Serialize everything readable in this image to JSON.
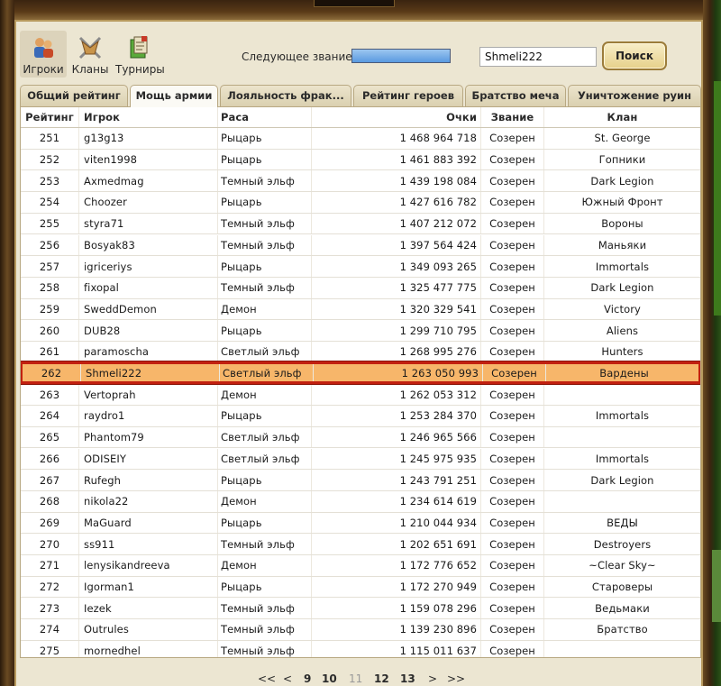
{
  "nav": [
    {
      "label": "Игроки",
      "active": true,
      "icon": "players-icon"
    },
    {
      "label": "Кланы",
      "active": false,
      "icon": "clans-icon"
    },
    {
      "label": "Турниры",
      "active": false,
      "icon": "tournaments-icon"
    }
  ],
  "next_rank": {
    "label": "Следующее звание:",
    "progress": 1.0
  },
  "search": {
    "value": "Shmeli222",
    "button": "Поиск"
  },
  "tabs": [
    {
      "label": "Общий рейтинг",
      "active": false
    },
    {
      "label": "Мощь армии",
      "active": true
    },
    {
      "label": "Лояльность фрак...",
      "active": false
    },
    {
      "label": "Рейтинг героев",
      "active": false
    },
    {
      "label": "Братство меча",
      "active": false
    },
    {
      "label": "Уничтожение руин",
      "active": false
    }
  ],
  "table": {
    "headers": {
      "rank": "Рейтинг",
      "player": "Игрок",
      "race": "Раса",
      "points": "Очки",
      "title": "Звание",
      "clan": "Клан"
    },
    "rows": [
      {
        "rank": "251",
        "player": "g13g13",
        "race": "Рыцарь",
        "points": "1 468 964 718",
        "title": "Созерен",
        "clan": "St. George"
      },
      {
        "rank": "252",
        "player": "viten1998",
        "race": "Рыцарь",
        "points": "1 461 883 392",
        "title": "Созерен",
        "clan": "Гопники"
      },
      {
        "rank": "253",
        "player": "Axmedmag",
        "race": "Темный эльф",
        "points": "1 439 198 084",
        "title": "Созерен",
        "clan": "Dark Legion"
      },
      {
        "rank": "254",
        "player": "Choozer",
        "race": "Рыцарь",
        "points": "1 427 616 782",
        "title": "Созерен",
        "clan": "Южный Фронт"
      },
      {
        "rank": "255",
        "player": "styra71",
        "race": "Темный эльф",
        "points": "1 407 212 072",
        "title": "Созерен",
        "clan": "Вороны"
      },
      {
        "rank": "256",
        "player": "Bosyak83",
        "race": "Темный эльф",
        "points": "1 397 564 424",
        "title": "Созерен",
        "clan": "Маньяки"
      },
      {
        "rank": "257",
        "player": "igriceriys",
        "race": "Рыцарь",
        "points": "1 349 093 265",
        "title": "Созерен",
        "clan": "Immortals"
      },
      {
        "rank": "258",
        "player": "fixopal",
        "race": "Темный эльф",
        "points": "1 325 477 775",
        "title": "Созерен",
        "clan": "Dark Legion"
      },
      {
        "rank": "259",
        "player": "SweddDemon",
        "race": "Демон",
        "points": "1 320 329 541",
        "title": "Созерен",
        "clan": "Victory"
      },
      {
        "rank": "260",
        "player": "DUB28",
        "race": "Рыцарь",
        "points": "1 299 710 795",
        "title": "Созерен",
        "clan": "Aliens"
      },
      {
        "rank": "261",
        "player": "paramoscha",
        "race": "Светлый эльф",
        "points": "1 268 995 276",
        "title": "Созерен",
        "clan": "Hunters"
      },
      {
        "rank": "262",
        "player": "Shmeli222",
        "race": "Светлый эльф",
        "points": "1 263 050 993",
        "title": "Созерен",
        "clan": "Вардены",
        "highlight": true
      },
      {
        "rank": "263",
        "player": "Vertoprah",
        "race": "Демон",
        "points": "1 262 053 312",
        "title": "Созерен",
        "clan": ""
      },
      {
        "rank": "264",
        "player": "raydro1",
        "race": "Рыцарь",
        "points": "1 253 284 370",
        "title": "Созерен",
        "clan": "Immortals"
      },
      {
        "rank": "265",
        "player": "Phantom79",
        "race": "Светлый эльф",
        "points": "1 246 965 566",
        "title": "Созерен",
        "clan": ""
      },
      {
        "rank": "266",
        "player": "ODISEIY",
        "race": "Светлый эльф",
        "points": "1 245 975 935",
        "title": "Созерен",
        "clan": "Immortals"
      },
      {
        "rank": "267",
        "player": "Rufegh",
        "race": "Рыцарь",
        "points": "1 243 791 251",
        "title": "Созерен",
        "clan": "Dark Legion"
      },
      {
        "rank": "268",
        "player": "nikola22",
        "race": "Демон",
        "points": "1 234 614 619",
        "title": "Созерен",
        "clan": ""
      },
      {
        "rank": "269",
        "player": "MaGuard",
        "race": "Рыцарь",
        "points": "1 210 044 934",
        "title": "Созерен",
        "clan": "ВЕДЫ"
      },
      {
        "rank": "270",
        "player": "ss911",
        "race": "Темный эльф",
        "points": "1 202 651 691",
        "title": "Созерен",
        "clan": "Destroyers"
      },
      {
        "rank": "271",
        "player": "lenysikandreeva",
        "race": "Демон",
        "points": "1 172 776 652",
        "title": "Созерен",
        "clan": "~Clear Sky~"
      },
      {
        "rank": "272",
        "player": "Igorman1",
        "race": "Рыцарь",
        "points": "1 172 270 949",
        "title": "Созерен",
        "clan": "Староверы"
      },
      {
        "rank": "273",
        "player": "Iezek",
        "race": "Темный эльф",
        "points": "1 159 078 296",
        "title": "Созерен",
        "clan": "Ведьмаки"
      },
      {
        "rank": "274",
        "player": "Outrules",
        "race": "Темный эльф",
        "points": "1 139 230 896",
        "title": "Созерен",
        "clan": "Братство"
      },
      {
        "rank": "275",
        "player": "mornedhel",
        "race": "Темный эльф",
        "points": "1 115 011 637",
        "title": "Созерен",
        "clan": ""
      }
    ]
  },
  "pagination": {
    "first": "<<",
    "prev": "<",
    "pages": [
      {
        "n": "9",
        "current": false
      },
      {
        "n": "10",
        "current": false
      },
      {
        "n": "11",
        "current": true
      },
      {
        "n": "12",
        "current": false
      },
      {
        "n": "13",
        "current": false
      }
    ],
    "next": ">",
    "last": ">>"
  },
  "colors": {
    "highlight_bg": "#f7b66a",
    "highlight_border": "#c22010",
    "panel_bg": "#ece6d2"
  }
}
